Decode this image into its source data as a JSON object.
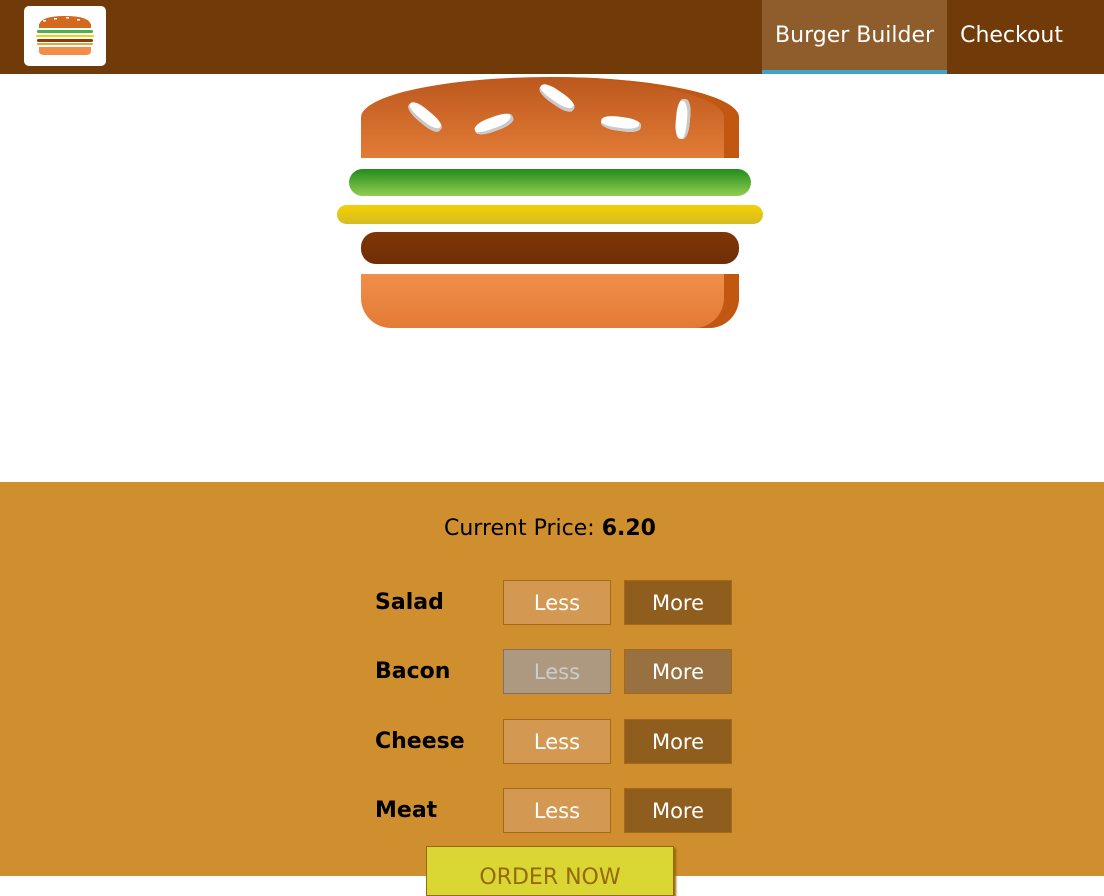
{
  "toolbar": {
    "logo_icon": "burger-logo-icon",
    "nav": [
      {
        "label": "Burger Builder",
        "active": true
      },
      {
        "label": "Checkout",
        "active": false
      }
    ],
    "background": "#703b09",
    "active_underline": "#40a4c8"
  },
  "burger": {
    "ingredients": [
      "salad",
      "cheese",
      "meat"
    ]
  },
  "controls": {
    "price_label": "Current Price:",
    "price_value": "6.20",
    "rows": [
      {
        "label": "Salad",
        "less": "Less",
        "more": "More",
        "less_disabled": false
      },
      {
        "label": "Bacon",
        "less": "Less",
        "more": "More",
        "less_disabled": true
      },
      {
        "label": "Cheese",
        "less": "Less",
        "more": "More",
        "less_disabled": false
      },
      {
        "label": "Meat",
        "less": "Less",
        "more": "More",
        "less_disabled": false
      }
    ],
    "order_button": "ORDER NOW",
    "background": "#cf8f2e"
  }
}
